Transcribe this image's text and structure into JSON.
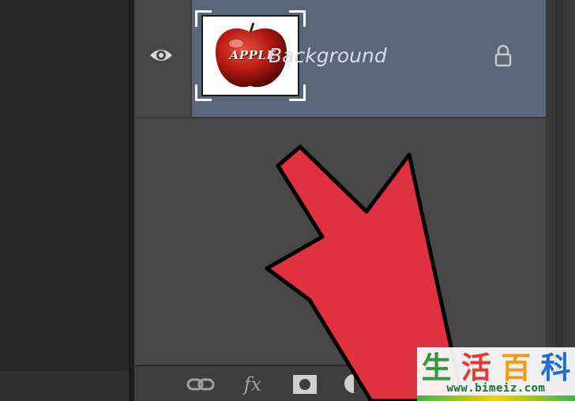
{
  "layers_panel": {
    "layer": {
      "name": "Background",
      "thumbnail_text": "APPLE",
      "visibility_icon": "eye-icon",
      "lock_icon": "lock-icon"
    },
    "toolbar": {
      "tools": [
        "link-icon",
        "fx-icon",
        "mask-icon",
        "adjustment-icon",
        "folder-icon"
      ],
      "fx_label": "fx"
    }
  },
  "annotation": {
    "arrow_color": "#e03140",
    "arrow_outline": "#000000"
  },
  "watermark": {
    "chars": [
      "生",
      "活",
      "百",
      "科"
    ],
    "char_colors": [
      "#2e9a3c",
      "#e53935",
      "#f39c12",
      "#1e6fd9"
    ],
    "url": "www.bimeiz.com"
  }
}
